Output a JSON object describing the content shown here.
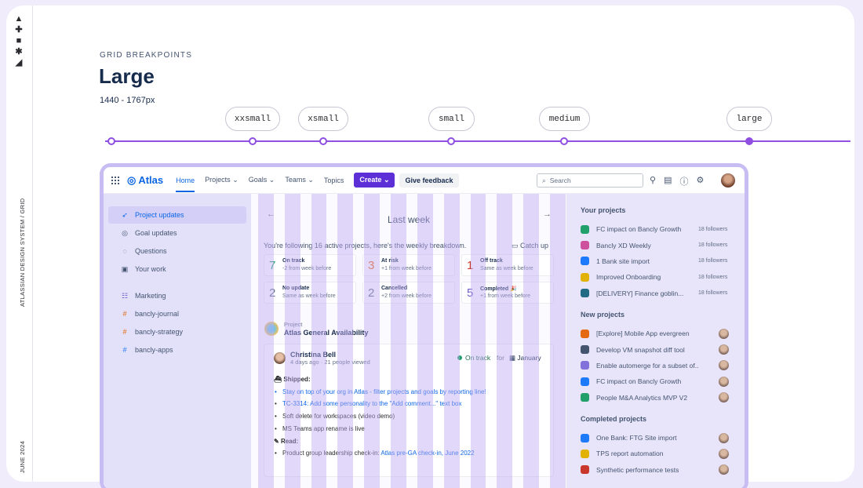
{
  "rail": {
    "logo_glyphs": [
      "▲",
      "✚",
      "■",
      "✱",
      "◢"
    ],
    "top_label": "ATLASSIAN DESIGN SYSTEM / GRID",
    "bottom_label": "JUNE 2024"
  },
  "header": {
    "eyebrow": "GRID BREAKPOINTS",
    "title": "Large",
    "range": "1440 - 1767px"
  },
  "breakpoints": [
    "xxsmall",
    "xsmall",
    "small",
    "medium",
    "large"
  ],
  "app": {
    "brand": "Atlas",
    "nav": [
      "Home",
      "Projects",
      "Goals",
      "Teams",
      "Topics"
    ],
    "create_label": "Create",
    "feedback_label": "Give feedback",
    "search_placeholder": "Search",
    "sidebar": {
      "items": [
        {
          "icon": "rocket-icon",
          "label": "Project updates"
        },
        {
          "icon": "target-icon",
          "label": "Goal updates"
        },
        {
          "icon": "chat-icon",
          "label": "Questions"
        },
        {
          "icon": "person-icon",
          "label": "Your work"
        }
      ],
      "teams": [
        {
          "icon": "people-icon",
          "label": "Marketing",
          "color": "#6e5dc6"
        },
        {
          "icon": "hash-icon",
          "label": "bancly-journal",
          "color": "#e56910"
        },
        {
          "icon": "hash-icon",
          "label": "bancly-strategy",
          "color": "#e56910"
        },
        {
          "icon": "hash-icon",
          "label": "bancly-apps",
          "color": "#1d7afc"
        }
      ]
    },
    "main": {
      "heading": "Last week",
      "following": "You're following 16 active projects, here's the weekly breakdown.",
      "catch_up": "Catch up",
      "stats": [
        {
          "num": "7",
          "label": "On track",
          "sub": "-2 from week before",
          "color": "#22a06b"
        },
        {
          "num": "3",
          "label": "At risk",
          "sub": "+1 from week before",
          "color": "#e56910"
        },
        {
          "num": "1",
          "label": "Off track",
          "sub": "Same as week before",
          "color": "#c9372c"
        },
        {
          "num": "2",
          "label": "No update",
          "sub": "Same as week before",
          "color": "#626f86"
        },
        {
          "num": "2",
          "label": "Cancelled",
          "sub": "+2 from week before",
          "color": "#626f86"
        },
        {
          "num": "5",
          "label": "Completed 🎉",
          "sub": "+1 from week before",
          "color": "#6e5dc6"
        }
      ],
      "project_label": "Project",
      "project_name": "Atlas General Availability",
      "update": {
        "author": "Christina Bell",
        "meta": "4 days ago · 21 people viewed",
        "status": "On track",
        "for": "for",
        "month": "January",
        "shipped": "Shipped:",
        "line1": "Stay on top of your org in Atlas - filter projects and goals by reporting line!",
        "line2_ticket": "TC-3314:",
        "line2_text": "Add some personality to the \"Add comment...\" text box",
        "line3": "Soft delete for workspaces (video demo)",
        "line4": "MS Teams app rename is live",
        "read": "Read:",
        "line5_prefix": "Product group leadership check-in:",
        "line5_link": "Atlas pre-GA check-in, June 2022"
      }
    },
    "right": {
      "your_projects_title": "Your projects",
      "your_projects": [
        {
          "name": "FC impact on Bancly Growth",
          "followers": "18 followers",
          "color": "#22a06b"
        },
        {
          "name": "Bancly XD Weekly",
          "followers": "18 followers",
          "color": "#cd519d"
        },
        {
          "name": "1 Bank site import",
          "followers": "18 followers",
          "color": "#1d7afc"
        },
        {
          "name": "Improved Onboarding",
          "followers": "18 followers",
          "color": "#e2b203"
        },
        {
          "name": "[DELIVERY] Finance goblin...",
          "followers": "18 followers",
          "color": "#206a83"
        }
      ],
      "new_projects_title": "New projects",
      "new_projects": [
        {
          "name": "[Explore] Mobile App evergreen",
          "color": "#e56910"
        },
        {
          "name": "Develop VM snapshot diff tool",
          "color": "#44546f"
        },
        {
          "name": "Enable automerge for a subset of...",
          "color": "#8270db"
        },
        {
          "name": "FC impact on Bancly Growth",
          "color": "#1d7afc"
        },
        {
          "name": "People M&A Analytics MVP V2",
          "color": "#22a06b"
        }
      ],
      "completed_title": "Completed projects",
      "completed": [
        {
          "name": "One Bank: FTG Site import",
          "color": "#1d7afc"
        },
        {
          "name": "TPS report automation",
          "color": "#e2b203"
        },
        {
          "name": "Synthetic performance tests",
          "color": "#c9372c"
        }
      ]
    }
  }
}
